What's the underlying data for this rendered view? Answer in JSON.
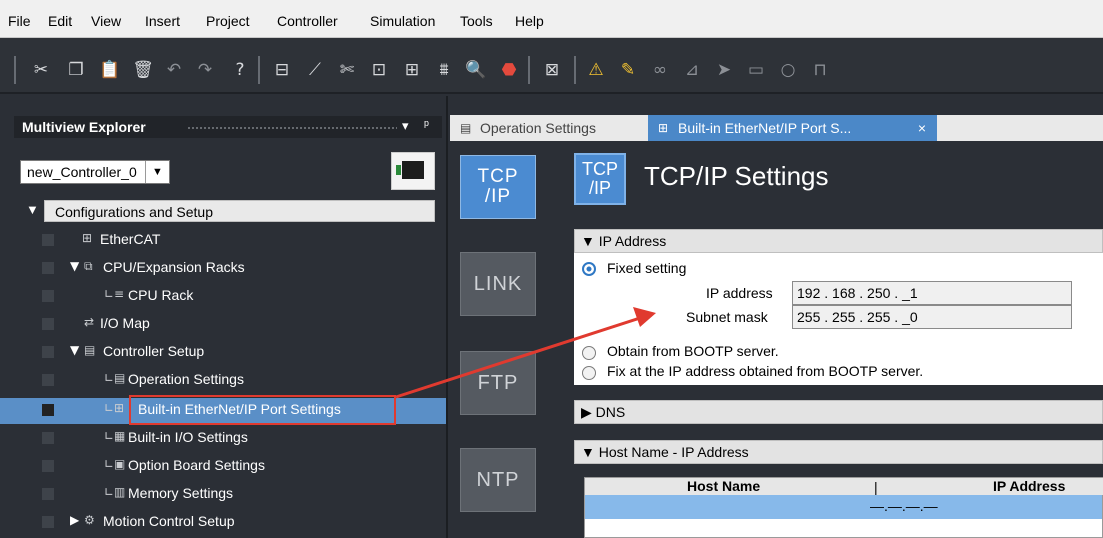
{
  "menu": [
    "File",
    "Edit",
    "View",
    "Insert",
    "Project",
    "Controller",
    "Simulation",
    "Tools",
    "Help"
  ],
  "toolbar": {
    "icons": [
      "cut-icon",
      "copy-icon",
      "paste-icon",
      "delete-icon",
      "undo-icon",
      "redo-icon",
      "help-icon",
      "build-icon",
      "online-icon",
      "scissors-icon",
      "sync-icon",
      "transfer-icon",
      "ladder-icon",
      "find-icon",
      "stop-icon",
      "compare-icon",
      "warning-icon",
      "pen-icon",
      "monitor-icon",
      "diagram-icon",
      "step-icon",
      "run-icon",
      "reset-icon",
      "io-icon"
    ]
  },
  "explorer": {
    "title": "Multiview Explorer",
    "pin_glyph": "▾",
    "pin_glyph2": "ᵖ",
    "controller_select": "new_Controller_0",
    "select_arrow": "▼",
    "config_header": "Configurations and Setup",
    "tree": [
      {
        "label": "EtherCAT",
        "icon": "🔳"
      },
      {
        "label": "CPU/Expansion Racks",
        "icon": "▼ ⧉"
      },
      {
        "label": "CPU Rack",
        "icon": "∟ ≡"
      },
      {
        "label": "I/O Map",
        "icon": "⇄"
      },
      {
        "label": "Controller Setup",
        "icon": "▼ ▤"
      },
      {
        "label": "Operation Settings",
        "icon": "∟ ▤"
      },
      {
        "label": "Built-in EtherNet/IP Port Settings",
        "icon": "∟ ⊞"
      },
      {
        "label": "Built-in I/O Settings",
        "icon": "∟ ▦"
      },
      {
        "label": "Option Board Settings",
        "icon": "∟ ▣"
      },
      {
        "label": "Memory Settings",
        "icon": "∟ ▥"
      },
      {
        "label": "Motion Control Setup",
        "icon": "▶ ⚙"
      }
    ]
  },
  "tabs": [
    {
      "label": "Operation Settings",
      "icon": "▤"
    },
    {
      "label": "Built-in EtherNet/IP Port S...",
      "icon": "⊞",
      "close": "×"
    }
  ],
  "side_buttons": {
    "tcp": "TCP\n/IP",
    "link": "LINK",
    "ftp": "FTP",
    "ntp": "NTP"
  },
  "tcp_settings": {
    "logo": "TCP\n/IP",
    "title": "TCP/IP Settings",
    "ip_header": "▼ IP Address",
    "fixed_label": "Fixed setting",
    "ip_label": "IP address",
    "ip_value": "192 . 168 . 250 . _1",
    "mask_label": "Subnet mask",
    "mask_value": "255 . 255 . 255 . _0",
    "bootp_label": "Obtain from BOOTP server.",
    "fixbootp_label": "Fix at the IP address obtained from BOOTP server.",
    "dns_header": "▶ DNS",
    "host_header": "▼ Host Name - IP Address",
    "host_col1": "Host Name",
    "host_sep": "|",
    "host_col2": "IP Address",
    "host_row_ip": "—.—.—.—"
  },
  "colors": {
    "accent": "#4b88c8",
    "selection": "#5a8fc7",
    "annotation": "#e03a2f"
  }
}
